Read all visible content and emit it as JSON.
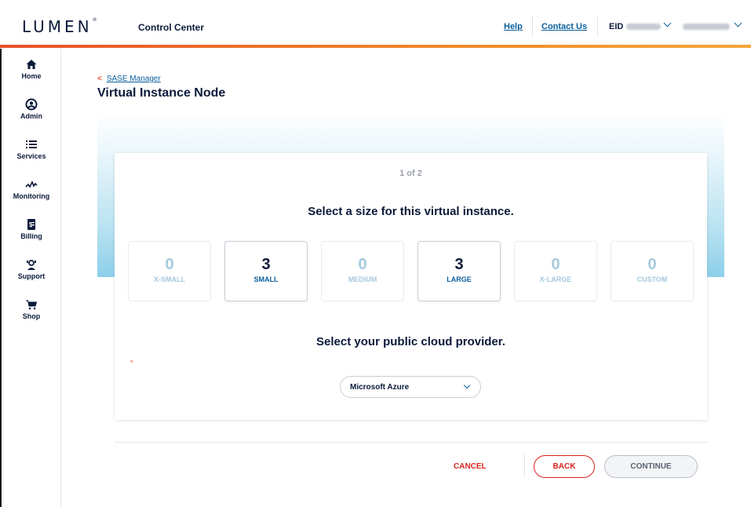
{
  "header": {
    "logo": "LUMEN",
    "logo_mark": "®",
    "app_title": "Control Center",
    "help_link": "Help",
    "contact_link": "Contact Us",
    "eid_label": "EID"
  },
  "sidebar": {
    "items": [
      {
        "label": "Home",
        "icon": "home-icon"
      },
      {
        "label": "Admin",
        "icon": "user-icon"
      },
      {
        "label": "Services",
        "icon": "list-icon"
      },
      {
        "label": "Monitoring",
        "icon": "pulse-icon"
      },
      {
        "label": "Billing",
        "icon": "invoice-icon"
      },
      {
        "label": "Support",
        "icon": "support-icon"
      },
      {
        "label": "Shop",
        "icon": "cart-icon"
      }
    ]
  },
  "breadcrumb": {
    "label": "SASE Manager"
  },
  "page_title": "Virtual Instance Node",
  "wizard": {
    "step": "1 of 2",
    "size_question": "Select a size for this virtual instance.",
    "sizes": [
      {
        "count": "0",
        "name": "X-SMALL",
        "active": false
      },
      {
        "count": "3",
        "name": "SMALL",
        "active": true
      },
      {
        "count": "0",
        "name": "MEDIUM",
        "active": false
      },
      {
        "count": "3",
        "name": "LARGE",
        "active": true
      },
      {
        "count": "0",
        "name": "X-LARGE",
        "active": false
      },
      {
        "count": "0",
        "name": "CUSTOM",
        "active": false
      }
    ],
    "provider_question": "Select your public cloud provider.",
    "required_mark": "*",
    "provider_selected": "Microsoft Azure"
  },
  "footer": {
    "cancel_label": "CANCEL",
    "back_label": "BACK",
    "continue_label": "CONTINUE"
  },
  "colors": {
    "accent_orange": "#e8512b",
    "brand_navy": "#0b1a3a",
    "link_blue": "#0a5e9a",
    "danger_red": "#d8261d"
  }
}
